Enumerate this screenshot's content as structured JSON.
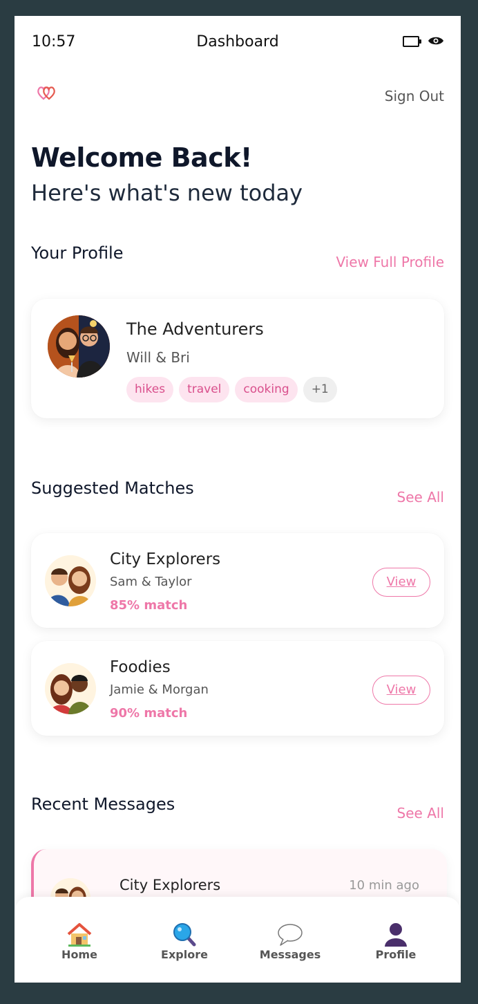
{
  "status_bar": {
    "time": "10:57",
    "title": "Dashboard",
    "battery_icon": "battery-icon",
    "eye_icon": "eye-icon"
  },
  "header": {
    "logo_icon": "hearts-logo-icon",
    "sign_out": "Sign Out"
  },
  "welcome": {
    "title": "Welcome Back!",
    "subtitle": "Here's what's new today"
  },
  "profile": {
    "section_title": "Your Profile",
    "view_full_profile": "View Full Profile",
    "name": "The Adventurers",
    "members": "Will & Bri",
    "tags": [
      "hikes",
      "travel",
      "cooking"
    ],
    "more_tags": "+1"
  },
  "suggested": {
    "section_title": "Suggested Matches",
    "see_all": "See All",
    "matches": [
      {
        "name": "City Explorers",
        "members": "Sam & Taylor",
        "match": "85% match",
        "view": "View"
      },
      {
        "name": "Foodies",
        "members": "Jamie & Morgan",
        "match": "90% match",
        "view": "View"
      }
    ]
  },
  "messages": {
    "section_title": "Recent Messages",
    "see_all": "See All",
    "items": [
      {
        "name": "City Explorers",
        "time": "10 min ago"
      }
    ]
  },
  "nav": [
    {
      "label": "Home",
      "icon": "house-icon"
    },
    {
      "label": "Explore",
      "icon": "magnifier-icon"
    },
    {
      "label": "Messages",
      "icon": "speech-bubble-icon"
    },
    {
      "label": "Profile",
      "icon": "person-icon"
    }
  ],
  "colors": {
    "accent": "#ee77a8",
    "tag_bg": "#fde4ef",
    "background": "#2a3c42"
  }
}
